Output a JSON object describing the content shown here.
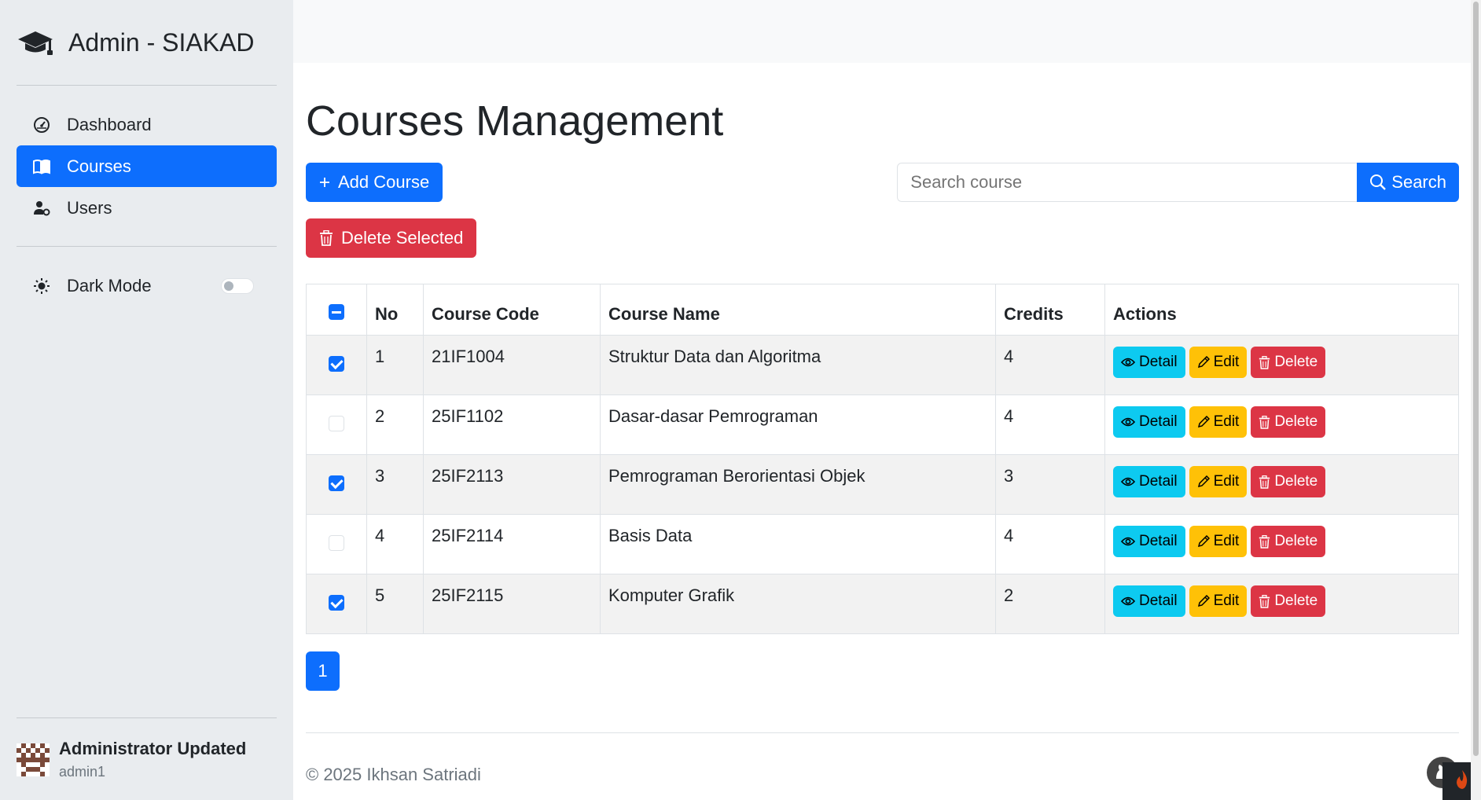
{
  "sidebar": {
    "brand_title": "Admin - SIAKAD",
    "nav": [
      {
        "label": "Dashboard",
        "icon": "speedometer-icon",
        "active": false
      },
      {
        "label": "Courses",
        "icon": "book-icon",
        "active": true
      },
      {
        "label": "Users",
        "icon": "user-gear-icon",
        "active": false
      }
    ],
    "dark_mode_label": "Dark Mode",
    "dark_mode_enabled": false,
    "user": {
      "name": "Administrator Updated",
      "username": "admin1"
    }
  },
  "main": {
    "page_title": "Courses Management",
    "add_button": "Add Course",
    "search_placeholder": "Search course",
    "search_button": "Search",
    "delete_selected": "Delete Selected",
    "table": {
      "headers": [
        "No",
        "Course Code",
        "Course Name",
        "Credits",
        "Actions"
      ],
      "rows": [
        {
          "no": "1",
          "code": "21IF1004",
          "name": "Struktur Data dan Algoritma",
          "credits": "4",
          "checked": true
        },
        {
          "no": "2",
          "code": "25IF1102",
          "name": "Dasar-dasar Pemrograman",
          "credits": "4",
          "checked": false
        },
        {
          "no": "3",
          "code": "25IF2113",
          "name": "Pemrograman Berorientasi Objek",
          "credits": "3",
          "checked": true
        },
        {
          "no": "4",
          "code": "25IF2114",
          "name": "Basis Data",
          "credits": "4",
          "checked": false
        },
        {
          "no": "5",
          "code": "25IF2115",
          "name": "Komputer Grafik",
          "credits": "2",
          "checked": true
        }
      ],
      "action_labels": {
        "detail": "Detail",
        "edit": "Edit",
        "delete": "Delete"
      }
    },
    "pagination": {
      "current_page": "1"
    },
    "footer": "© 2025 Ikhsan Satriadi"
  },
  "colors": {
    "primary": "#0d6efd",
    "danger": "#dc3545",
    "info": "#0dcaf0",
    "warning": "#ffc107",
    "sidebar_bg": "#e9ecef"
  }
}
